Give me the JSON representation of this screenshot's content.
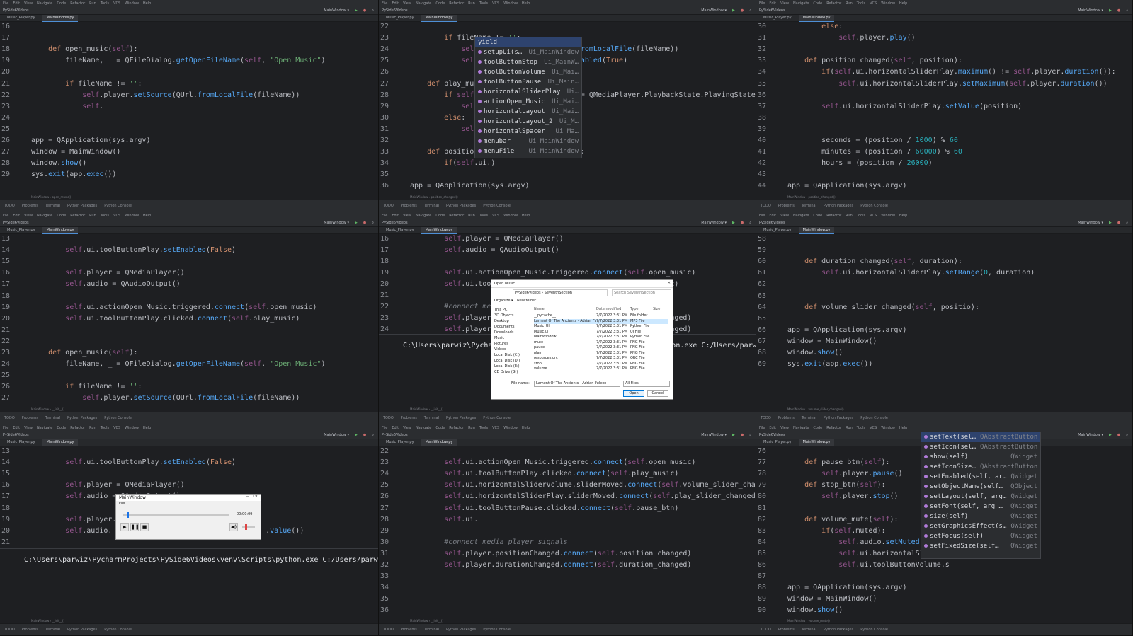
{
  "ide": {
    "menu_items": [
      "File",
      "Edit",
      "View",
      "Navigate",
      "Code",
      "Refactor",
      "Run",
      "Tools",
      "VCS",
      "Window",
      "Help"
    ],
    "project": "PySide6Videos",
    "config": "MainWindow",
    "status": [
      "TODO",
      "Problems",
      "Terminal",
      "Python Packages",
      "Python Console"
    ]
  },
  "panels": [
    {
      "tab_active": "MainWindow.py",
      "tab_other": "Music_Player.py",
      "breadcrumb": "MainWindow › open_music()",
      "lines": [
        {
          "n": "16",
          "t": ""
        },
        {
          "n": "17",
          "t": ""
        },
        {
          "n": "18",
          "t": "    def open_music(self):"
        },
        {
          "n": "19",
          "t": "        fileName, _ = QFileDialog.getOpenFileName(self, \"Open Music\")"
        },
        {
          "n": "20",
          "t": ""
        },
        {
          "n": "21",
          "t": "        if fileName != '':"
        },
        {
          "n": "22",
          "t": "            self.player.setSource(QUrl.fromLocalFile(fileName))"
        },
        {
          "n": "23",
          "t": "            self."
        },
        {
          "n": "24",
          "t": ""
        },
        {
          "n": "25",
          "t": ""
        },
        {
          "n": "26",
          "t": "app = QApplication(sys.argv)"
        },
        {
          "n": "27",
          "t": "window = MainWindow()"
        },
        {
          "n": "28",
          "t": "window.show()"
        },
        {
          "n": "29",
          "t": "sys.exit(app.exec())"
        }
      ]
    },
    {
      "tab_active": "MainWindow.py",
      "tab_other": "Music_Player.py",
      "breadcrumb": "MainWindow › position_changed()",
      "lines": [
        {
          "n": "22",
          "t": ""
        },
        {
          "n": "23",
          "t": "        if fileName != '':"
        },
        {
          "n": "24",
          "t": "            self.player.setSource(QUrl.fromLocalFile(fileName))"
        },
        {
          "n": "25",
          "t": "            self.ui.toolButtonPlay.setEnabled(True)"
        },
        {
          "n": "26",
          "t": ""
        },
        {
          "n": "27",
          "t": "    def play_music(self):"
        },
        {
          "n": "28",
          "t": "        if self.player.playbackState() == QMediaPlayer.PlaybackState.PlayingState:"
        },
        {
          "n": "29",
          "t": "            self.player.pause()"
        },
        {
          "n": "30",
          "t": "        else:"
        },
        {
          "n": "31",
          "t": "            self.player.play()"
        },
        {
          "n": "32",
          "t": ""
        },
        {
          "n": "33",
          "t": "    def position_changed(self, position):"
        },
        {
          "n": "34",
          "t": "        if(self.ui.)"
        },
        {
          "n": "35",
          "t": ""
        },
        {
          "n": "36",
          "t": "app = QApplication(sys.argv)"
        }
      ],
      "popup": [
        {
          "name": "yield",
          "type": ""
        },
        {
          "name": "setupUi(s…",
          "type": "Ui_MainWindow"
        },
        {
          "name": "toolButtonStop",
          "type": "Ui_MainW…"
        },
        {
          "name": "toolButtonVolume",
          "type": "Ui_Mai…"
        },
        {
          "name": "toolButtonPause",
          "type": "Ui_Main…"
        },
        {
          "name": "horizontalSliderPlay",
          "type": "Ui…"
        },
        {
          "name": "actionOpen_Music",
          "type": "Ui_Mai…"
        },
        {
          "name": "horizontalLayout",
          "type": "Ui_Mai…"
        },
        {
          "name": "horizontalLayout_2",
          "type": "Ui_M…"
        },
        {
          "name": "horizontalSpacer",
          "type": "Ui_Ma…"
        },
        {
          "name": "menubar",
          "type": "Ui_MainWindow"
        },
        {
          "name": "menuFile",
          "type": "Ui_MainWindow"
        }
      ]
    },
    {
      "tab_active": "MainWindow.py",
      "tab_other": "Music_Player.py",
      "breadcrumb": "MainWindow › position_changed()",
      "lines": [
        {
          "n": "30",
          "t": "        else:"
        },
        {
          "n": "31",
          "t": "            self.player.play()"
        },
        {
          "n": "32",
          "t": ""
        },
        {
          "n": "33",
          "t": "    def position_changed(self, position):"
        },
        {
          "n": "34",
          "t": "        if(self.ui.horizontalSliderPlay.maximum() != self.player.duration()):"
        },
        {
          "n": "35",
          "t": "            self.ui.horizontalSliderPlay.setMaximum(self.player.duration())"
        },
        {
          "n": "36",
          "t": ""
        },
        {
          "n": "37",
          "t": "        self.ui.horizontalSliderPlay.setValue(position)"
        },
        {
          "n": "38",
          "t": ""
        },
        {
          "n": "39",
          "t": ""
        },
        {
          "n": "40",
          "t": "        seconds = (position / 1000) % 60"
        },
        {
          "n": "41",
          "t": "        minutes = (position / 60000) % 60"
        },
        {
          "n": "42",
          "t": "        hours = (position / 26000)"
        },
        {
          "n": "43",
          "t": ""
        },
        {
          "n": "44",
          "t": "app = QApplication(sys.argv)"
        }
      ]
    },
    {
      "tab_active": "MainWindow.py",
      "tab_other": "Music_Player.py",
      "breadcrumb": "MainWindow › __init__()",
      "lines": [
        {
          "n": "13",
          "t": ""
        },
        {
          "n": "14",
          "t": "        self.ui.toolButtonPlay.setEnabled(False)"
        },
        {
          "n": "15",
          "t": ""
        },
        {
          "n": "16",
          "t": "        self.player = QMediaPlayer()"
        },
        {
          "n": "17",
          "t": "        self.audio = QAudioOutput()"
        },
        {
          "n": "18",
          "t": ""
        },
        {
          "n": "19",
          "t": "        self.ui.actionOpen_Music.triggered.connect(self.open_music)"
        },
        {
          "n": "20",
          "t": "        self.ui.toolButtonPlay.clicked.connect(self.play_music)"
        },
        {
          "n": "21",
          "t": ""
        },
        {
          "n": "22",
          "t": ""
        },
        {
          "n": "23",
          "t": "    def open_music(self):"
        },
        {
          "n": "24",
          "t": "        fileName, _ = QFileDialog.getOpenFileName(self, \"Open Music\")"
        },
        {
          "n": "25",
          "t": ""
        },
        {
          "n": "26",
          "t": "        if fileName != '':"
        },
        {
          "n": "27",
          "t": "            self.player.setSource(QUrl.fromLocalFile(fileName))"
        }
      ]
    },
    {
      "tab_active": "MainWindow.py",
      "tab_other": "Music_Player.py",
      "breadcrumb": "MainWindow › __init__()",
      "lines": [
        {
          "n": "16",
          "t": "        self.player = QMediaPlayer()"
        },
        {
          "n": "17",
          "t": "        self.audio = QAudioOutput()"
        },
        {
          "n": "18",
          "t": ""
        },
        {
          "n": "19",
          "t": "        self.ui.actionOpen_Music.triggered.connect(self.open_music)"
        },
        {
          "n": "20",
          "t": "        self.ui.toolButtonPlay.clicked.connect(self.play_music)"
        },
        {
          "n": "21",
          "t": ""
        },
        {
          "n": "22",
          "t": "        #connect media player signals"
        },
        {
          "n": "23",
          "t": "        self.player.positionChanged.connect(self.position_changed)"
        },
        {
          "n": "24",
          "t": "        self.player.durationChanged.connect(self.duration_changed)"
        }
      ],
      "terminal": "C:\\Users\\parwiz\\PycharmProjects\\PySide6Videos\\venv\\Scripts\\python.exe C:/Users/parwiz/Pych",
      "dialog": {
        "title": "Open Music",
        "path": "PySide6Videos › SeventhSection",
        "search": "Search SeventhSection",
        "organize": "Organize ▾",
        "new_folder": "New folder",
        "nav": [
          "This PC",
          "3D Objects",
          "Desktop",
          "Documents",
          "Downloads",
          "Music",
          "Pictures",
          "Videos",
          "Local Disk (C:)",
          "Local Disk (D:)",
          "Local Disk (E:)",
          "CD Drive (G:)"
        ],
        "columns": [
          "Name",
          "Date modified",
          "Type",
          "Size"
        ],
        "files": [
          {
            "name": "__pycache__",
            "date": "7/7/2022 3:31 PM",
            "type": "File folder",
            "size": ""
          },
          {
            "name": "Lament Of The Ancients - Adrian Fuleen",
            "date": "7/7/2022 3:31 PM",
            "type": "MP3 File",
            "size": ""
          },
          {
            "name": "Music_UI",
            "date": "7/7/2022 3:31 PM",
            "type": "Python File",
            "size": ""
          },
          {
            "name": "Music.ui",
            "date": "7/7/2022 3:31 PM",
            "type": "UI File",
            "size": ""
          },
          {
            "name": "MainWindow",
            "date": "7/7/2022 3:31 PM",
            "type": "Python File",
            "size": ""
          },
          {
            "name": "mute",
            "date": "7/7/2022 3:31 PM",
            "type": "PNG File",
            "size": ""
          },
          {
            "name": "pause",
            "date": "7/7/2022 3:31 PM",
            "type": "PNG File",
            "size": ""
          },
          {
            "name": "play",
            "date": "7/7/2022 3:31 PM",
            "type": "PNG File",
            "size": ""
          },
          {
            "name": "resources.qrc",
            "date": "7/7/2022 3:31 PM",
            "type": "QRC File",
            "size": ""
          },
          {
            "name": "stop",
            "date": "7/7/2022 3:31 PM",
            "type": "PNG File",
            "size": ""
          },
          {
            "name": "volume",
            "date": "7/7/2022 3:31 PM",
            "type": "PNG File",
            "size": ""
          }
        ],
        "filename_label": "File name:",
        "filename": "Lament Of The Ancients - Adrian Fuleen",
        "filter": "All Files",
        "open": "Open",
        "cancel": "Cancel"
      }
    },
    {
      "tab_active": "MainWindow.py",
      "tab_other": "Music_Player.py",
      "breadcrumb": "MainWindow › volume_slider_changed()",
      "lines": [
        {
          "n": "58",
          "t": ""
        },
        {
          "n": "59",
          "t": ""
        },
        {
          "n": "60",
          "t": "    def duration_changed(self, duration):"
        },
        {
          "n": "61",
          "t": "        self.ui.horizontalSliderPlay.setRange(0, duration)"
        },
        {
          "n": "62",
          "t": ""
        },
        {
          "n": "63",
          "t": ""
        },
        {
          "n": "64",
          "t": "    def volume_slider_changed(self, positio):"
        },
        {
          "n": "65",
          "t": ""
        },
        {
          "n": "66",
          "t": "app = QApplication(sys.argv)"
        },
        {
          "n": "67",
          "t": "window = MainWindow()"
        },
        {
          "n": "68",
          "t": "window.show()"
        },
        {
          "n": "69",
          "t": "sys.exit(app.exec())"
        }
      ]
    },
    {
      "tab_active": "MainWindow.py",
      "tab_other": "Music_Player.py",
      "breadcrumb": "MainWindow › __init__()",
      "lines": [
        {
          "n": "13",
          "t": ""
        },
        {
          "n": "14",
          "t": "        self.ui.toolButtonPlay.setEnabled(False)"
        },
        {
          "n": "15",
          "t": ""
        },
        {
          "n": "16",
          "t": "        self.player = QMediaPlayer()"
        },
        {
          "n": "17",
          "t": "        self.audio = QAudioOutput()"
        },
        {
          "n": "18",
          "t": ""
        },
        {
          "n": "19",
          "t": "        self.player."
        },
        {
          "n": "20",
          "t": "        self.audio.                                    .value())"
        },
        {
          "n": "21",
          "t": ""
        }
      ],
      "terminal": "C:\\Users\\parwiz\\PycharmProjects\\PySide6Videos\\venv\\Scripts\\python.exe C:/Users/parwiz/Pych",
      "player": {
        "title": "MainWindow",
        "menu": "File",
        "time": "00:00:09",
        "progress": 0.03,
        "volume": 0.2
      }
    },
    {
      "tab_active": "MainWindow.py",
      "tab_other": "Music_Player.py",
      "breadcrumb": "MainWindow › __init__()",
      "lines": [
        {
          "n": "22",
          "t": ""
        },
        {
          "n": "23",
          "t": "        self.ui.actionOpen_Music.triggered.connect(self.open_music)"
        },
        {
          "n": "24",
          "t": "        self.ui.toolButtonPlay.clicked.connect(self.play_music)"
        },
        {
          "n": "25",
          "t": "        self.ui.horizontalSliderVolume.sliderMoved.connect(self.volume_slider_changed)"
        },
        {
          "n": "26",
          "t": "        self.ui.horizontalSliderPlay.sliderMoved.connect(self.play_slider_changed)"
        },
        {
          "n": "27",
          "t": "        self.ui.toolButtonPause.clicked.connect(self.pause_btn)"
        },
        {
          "n": "28",
          "t": "        self.ui."
        },
        {
          "n": "29",
          "t": ""
        },
        {
          "n": "30",
          "t": "        #connect media player signals"
        },
        {
          "n": "31",
          "t": "        self.player.positionChanged.connect(self.position_changed)"
        },
        {
          "n": "32",
          "t": "        self.player.durationChanged.connect(self.duration_changed)"
        },
        {
          "n": "33",
          "t": ""
        },
        {
          "n": "34",
          "t": ""
        },
        {
          "n": "35",
          "t": ""
        },
        {
          "n": "36",
          "t": ""
        }
      ]
    },
    {
      "tab_active": "MainWindow.py",
      "tab_other": "Music_Player.py",
      "breadcrumb": "MainWindow › volume_mute()",
      "lines": [
        {
          "n": "76",
          "t": ""
        },
        {
          "n": "77",
          "t": "    def pause_btn(self):"
        },
        {
          "n": "78",
          "t": "        self.player.pause()"
        },
        {
          "n": "79",
          "t": "    def stop_btn(self):"
        },
        {
          "n": "80",
          "t": "        self.player.stop()"
        },
        {
          "n": "81",
          "t": ""
        },
        {
          "n": "82",
          "t": "    def volume_mute(self):"
        },
        {
          "n": "83",
          "t": "        if(self.muted):"
        },
        {
          "n": "84",
          "t": "            self.audio.setMuted(True)"
        },
        {
          "n": "85",
          "t": "            self.ui.horizontalSlide"
        },
        {
          "n": "86",
          "t": "            self.ui.toolButtonVolume.s"
        },
        {
          "n": "87",
          "t": ""
        },
        {
          "n": "88",
          "t": "app = QApplication(sys.argv)"
        },
        {
          "n": "89",
          "t": "window = MainWindow()"
        },
        {
          "n": "90",
          "t": "window.show()"
        }
      ],
      "popup": [
        {
          "name": "setText(sel…",
          "type": "QAbstractButton"
        },
        {
          "name": "setIcon(sel…",
          "type": "QAbstractButton"
        },
        {
          "name": "show(self)",
          "type": "QWidget"
        },
        {
          "name": "setIconSize…",
          "type": "QAbstractButton"
        },
        {
          "name": "setEnabled(self, ar…",
          "type": "QWidget"
        },
        {
          "name": "setObjectName(self…",
          "type": "QObject"
        },
        {
          "name": "setLayout(self, arg…",
          "type": "QWidget"
        },
        {
          "name": "setFont(self, arg_…",
          "type": "QWidget"
        },
        {
          "name": "size(self)",
          "type": "QWidget"
        },
        {
          "name": "setGraphicsEffect(s…",
          "type": "QWidget"
        },
        {
          "name": "setFocus(self)",
          "type": "QWidget"
        },
        {
          "name": "setFixedSize(self…",
          "type": "QWidget"
        }
      ]
    }
  ]
}
